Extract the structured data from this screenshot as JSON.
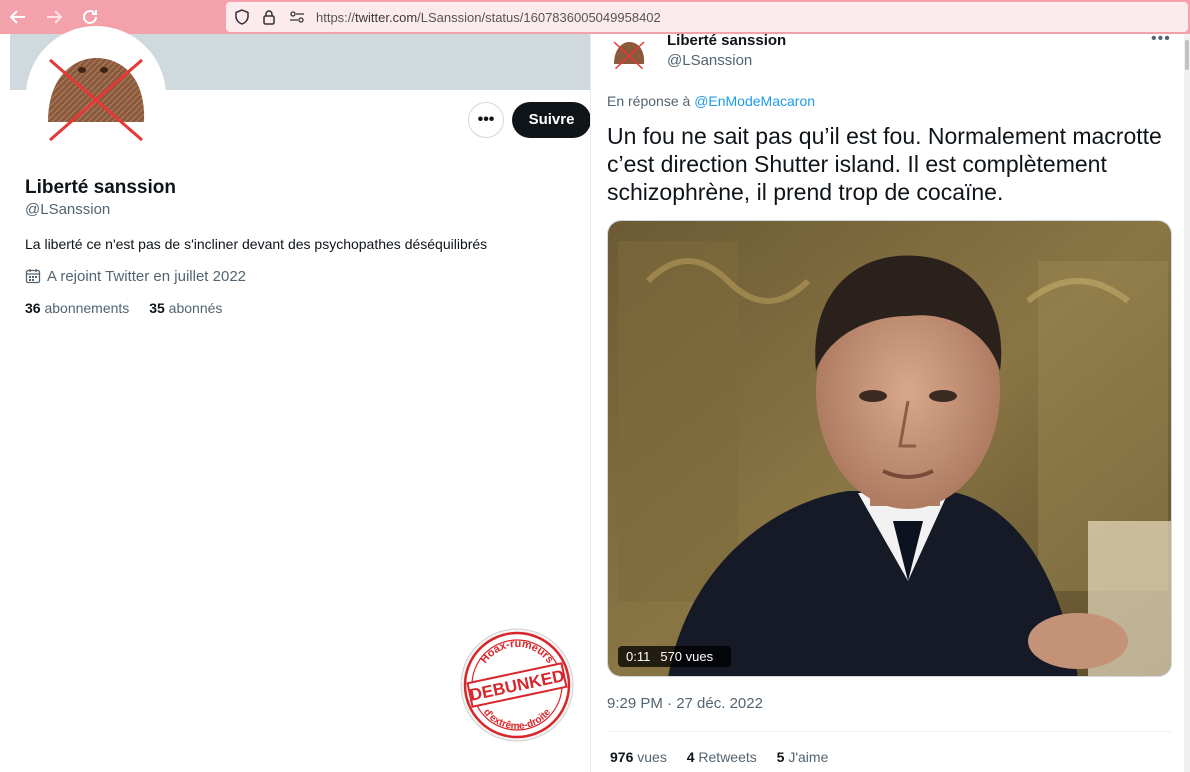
{
  "browser": {
    "url_prefix": "https://",
    "url_host": "twitter.com",
    "url_path": "/LSanssion/status/1607836005049958402",
    "back_icon": "arrow-left-icon",
    "forward_icon": "arrow-right-icon",
    "reload_icon": "reload-icon"
  },
  "profile": {
    "name": "Liberté sanssion",
    "handle": "@LSanssion",
    "bio": "La liberté ce n'est pas de s'incliner devant des psychopathes déséquilibrés",
    "joined": "A rejoint Twitter en juillet 2022",
    "following_count": "36",
    "following_label": "abonnements",
    "followers_count": "35",
    "followers_label": "abonnés",
    "follow_label": "Suivre",
    "more_label": "•••"
  },
  "tweet": {
    "author_name": "Liberté sanssion",
    "author_handle": "@LSanssion",
    "more_label": "•••",
    "reply_prefix": "En réponse à",
    "reply_to": "@EnModeMacaron",
    "text": "Un fou ne sait pas qu’il est fou. Normalement macrotte c’est direction Shutter island. Il est complètement schizophrène, il prend trop de cocaïne.",
    "video_duration": "0:11",
    "video_views": "570 vues",
    "timestamp": "9:29 PM · 27 déc. 2022",
    "views_count": "976",
    "views_label": "vues",
    "retweets_count": "4",
    "retweets_label": "Retweets",
    "likes_count": "5",
    "likes_label": "J'aime"
  },
  "stamp": {
    "top_text": "Hoax-rumeurs",
    "main_text": "DEBUNKED",
    "bottom_text": "d'extrême-droite",
    "color": "#d9262b"
  },
  "colors": {
    "link": "#1d9bf0",
    "browser_bar": "#f3a1ab",
    "follow_button": "#0f1419"
  }
}
